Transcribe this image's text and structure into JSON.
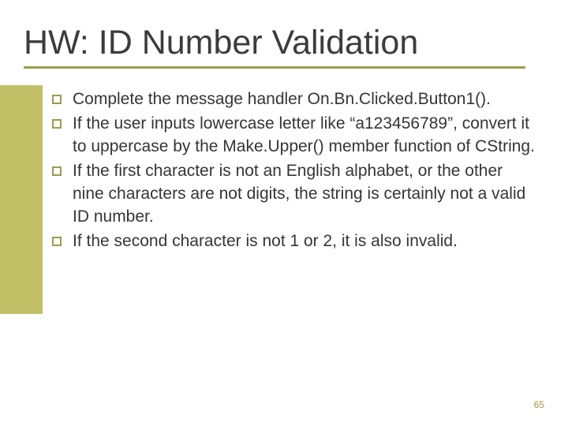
{
  "title": "HW: ID Number Validation",
  "bullets": [
    "Complete the message handler On.Bn.Clicked.Button1().",
    "If the user inputs lowercase letter like “a123456789”, convert it to uppercase by the Make.Upper() member function of CString.",
    "If the first character is not an English alphabet, or the other nine characters are not digits, the string is certainly not a valid ID number.",
    "If the second character is not 1 or 2, it is also invalid."
  ],
  "page_number": "65"
}
